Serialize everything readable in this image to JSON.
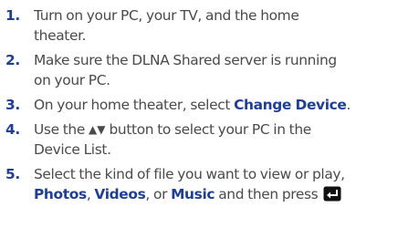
{
  "steps": [
    {
      "number": "1.",
      "text": "Turn on your PC, your TV, and the home\ntheater."
    },
    {
      "number": "2.",
      "text": "Make sure the DLNA Shared server is running\non your PC."
    },
    {
      "number": "3.",
      "text_before": "On your home theater, select ",
      "keyword": "Change Device",
      "text_after": "."
    },
    {
      "number": "4.",
      "text_before": "Use the ",
      "arrows": "▲▼",
      "text_after": " button to select your PC in the\nDevice List."
    },
    {
      "number": "5.",
      "text_before": "Select the kind of file you want to view or play,\n",
      "kw1": "Photos",
      "sep1": ", ",
      "kw2": "Videos",
      "sep2": ", or ",
      "kw3": "Music",
      "text_after": " and then press ",
      "icon": "enter-button-icon"
    }
  ],
  "colors": {
    "text": "#4a4a4a",
    "accent": "#1f3f94"
  }
}
